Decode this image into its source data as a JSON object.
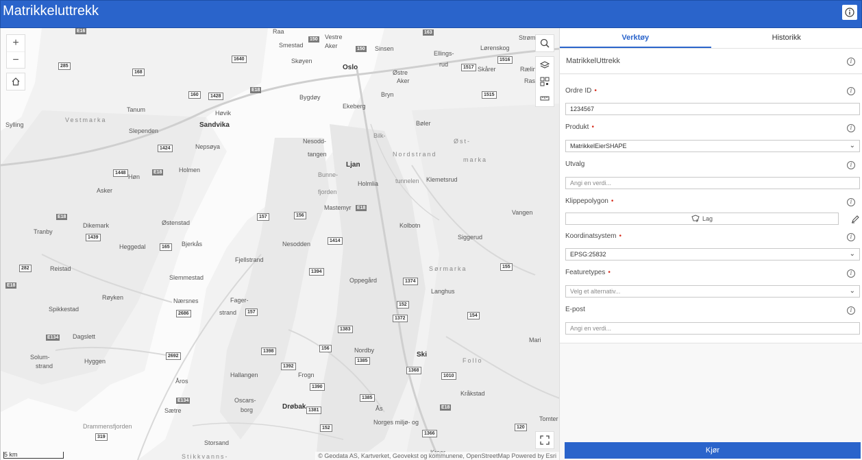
{
  "header": {
    "title": "Matrikkeluttrekk",
    "info_icon": "info-icon"
  },
  "map": {
    "controls": {
      "zoom_in": "+",
      "zoom_out": "−",
      "home_icon": "home-icon"
    },
    "right_tools": [
      "search-icon",
      "layers-icon",
      "qr-select-icon",
      "measure-icon"
    ],
    "fullscreen_icon": "fullscreen-icon",
    "scale": "5 km",
    "attribution": "© Geodata AS, Kartverket, Geovekst og kommunene, OpenStreetMap   Powered by Esri",
    "labels": {
      "cities": [
        "Oslo",
        "Sandvika",
        "Ljan",
        "Ski",
        "Drøbak"
      ],
      "places": [
        "Raa",
        "Vestre",
        "Aker",
        "Smestad",
        "Sinsen",
        "Ellings-",
        "rud",
        "Lørenskog",
        "Strømr",
        "Skøyen",
        "Østre",
        "Aker",
        "Skårer",
        "Rælin",
        "Rasta",
        "Bygdøy",
        "Bryn",
        "Ekeberg",
        "Tanum",
        "Høvik",
        "Sylling",
        "Slependen",
        "Nepsøya",
        "Bøler",
        "Nesodd-",
        "tangen",
        "Holmen",
        "Høn",
        "Bunne-",
        "Holmlia",
        "Klemetsrud",
        "Asker",
        "Mastemyr",
        "Vangen",
        "Dikemark",
        "Østenstad",
        "Kolbotn",
        "Tranby",
        "Heggedal",
        "Bjerkås",
        "Nesodden",
        "Siggerud",
        "Fjellstrand",
        "Reistad",
        "Slemmestad",
        "Oppegård",
        "Røyken",
        "Nærsnes",
        "Fager-",
        "strand",
        "Langhus",
        "Spikkestad",
        "Dagslett",
        "Solum-",
        "strand",
        "Hyggen",
        "Nordby",
        "Mari",
        "Hallangen",
        "Frogn",
        "Åros",
        "Oscars-",
        "borg",
        "Kråkstad",
        "Sætre",
        "Ås",
        "Tomter",
        "Storsand",
        "Norges miljø- og",
        "Kroer"
      ],
      "regions": [
        "Vestmarka",
        "Øst-",
        "marka",
        "Nordstrand",
        "Sørmarka",
        "Follo",
        "Stikkvanns-"
      ],
      "water": [
        "fjorden",
        "Drammensfjorden",
        "Bilk-",
        "tunnelen"
      ]
    }
  },
  "panel": {
    "tabs": [
      {
        "label": "Verktøy",
        "active": true
      },
      {
        "label": "Historikk",
        "active": false
      }
    ],
    "widget_title": "MatrikkelUttrekk",
    "fields": {
      "ordre_id": {
        "label": "Ordre ID",
        "value": "1234567"
      },
      "produkt": {
        "label": "Produkt",
        "value": "MatrikkelEierSHAPE"
      },
      "utvalg": {
        "label": "Utvalg",
        "placeholder": "Angi en verdi..."
      },
      "klippepolygon": {
        "label": "Klippepolygon",
        "button": "Lag"
      },
      "koordinatsystem": {
        "label": "Koordinatsystem",
        "value": "EPSG:25832"
      },
      "featuretypes": {
        "label": "Featuretypes",
        "placeholder": "Velg et alternativ..."
      },
      "epost": {
        "label": "E-post",
        "placeholder": "Angi en verdi..."
      }
    },
    "run_button": "Kjør"
  }
}
